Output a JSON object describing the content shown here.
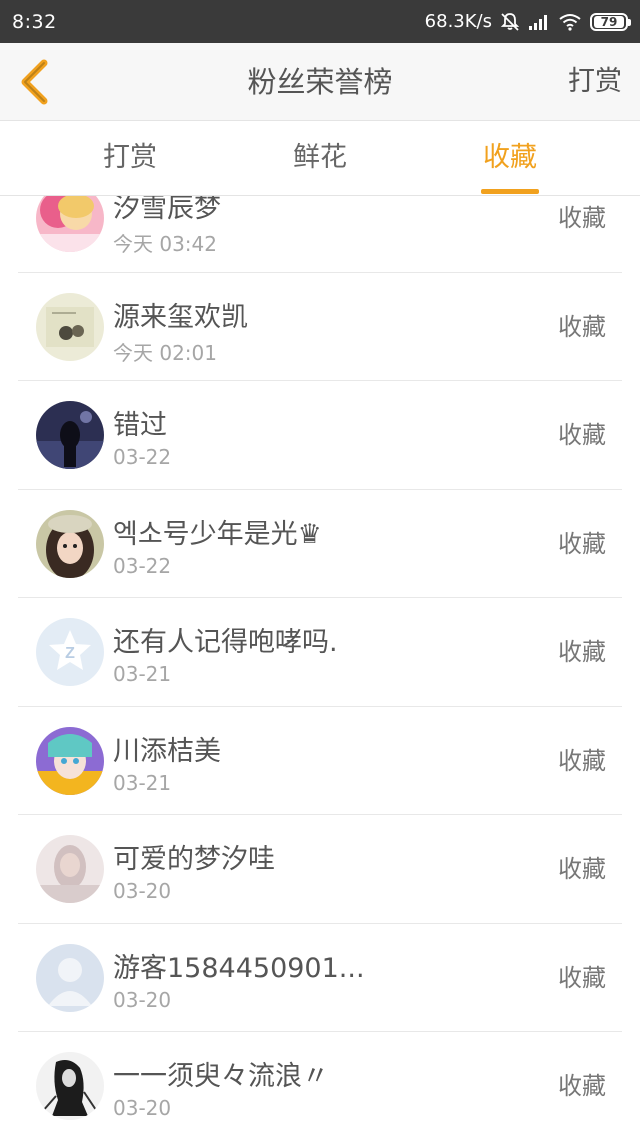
{
  "status_bar": {
    "time": "8:32",
    "network_speed": "68.3K/s",
    "battery": "79",
    "icons": [
      "bell-off-icon",
      "signal-icon",
      "wifi-icon",
      "battery-icon"
    ]
  },
  "header": {
    "title": "粉丝荣誉榜",
    "action": "打赏",
    "back_icon": "chevron-left-icon"
  },
  "tabs": [
    {
      "label": "打赏",
      "active": false
    },
    {
      "label": "鲜花",
      "active": false
    },
    {
      "label": "收藏",
      "active": true
    }
  ],
  "colors": {
    "accent": "#f1a11e",
    "status_bar": "#3a3a3a",
    "text_primary": "#555555",
    "text_secondary": "#a6a6a6"
  },
  "list": [
    {
      "name": "汐雪辰梦",
      "time": "今天 03:42",
      "action": "收藏",
      "avatar": "avatar-pink-girl"
    },
    {
      "name": "源来玺欢凯",
      "time": "今天 02:01",
      "action": "收藏",
      "avatar": "avatar-sketch"
    },
    {
      "name": "错过",
      "time": "03-22",
      "action": "收藏",
      "avatar": "avatar-night-figure"
    },
    {
      "name": "엑소号少年是光♛",
      "time": "03-22",
      "action": "收藏",
      "avatar": "avatar-girl-cap"
    },
    {
      "name": "还有人记得咆哮吗.",
      "time": "03-21",
      "action": "收藏",
      "avatar": "avatar-default-qzone"
    },
    {
      "name": "川添桔美",
      "time": "03-21",
      "action": "收藏",
      "avatar": "avatar-anime"
    },
    {
      "name": "可爱的梦汐哇",
      "time": "03-20",
      "action": "收藏",
      "avatar": "avatar-blurred-girl"
    },
    {
      "name": "游客1584450901...",
      "time": "03-20",
      "action": "收藏",
      "avatar": "avatar-default-person"
    },
    {
      "name": "一一须臾々流浪〃",
      "time": "03-20",
      "action": "收藏",
      "avatar": "avatar-bw-sketch"
    }
  ]
}
